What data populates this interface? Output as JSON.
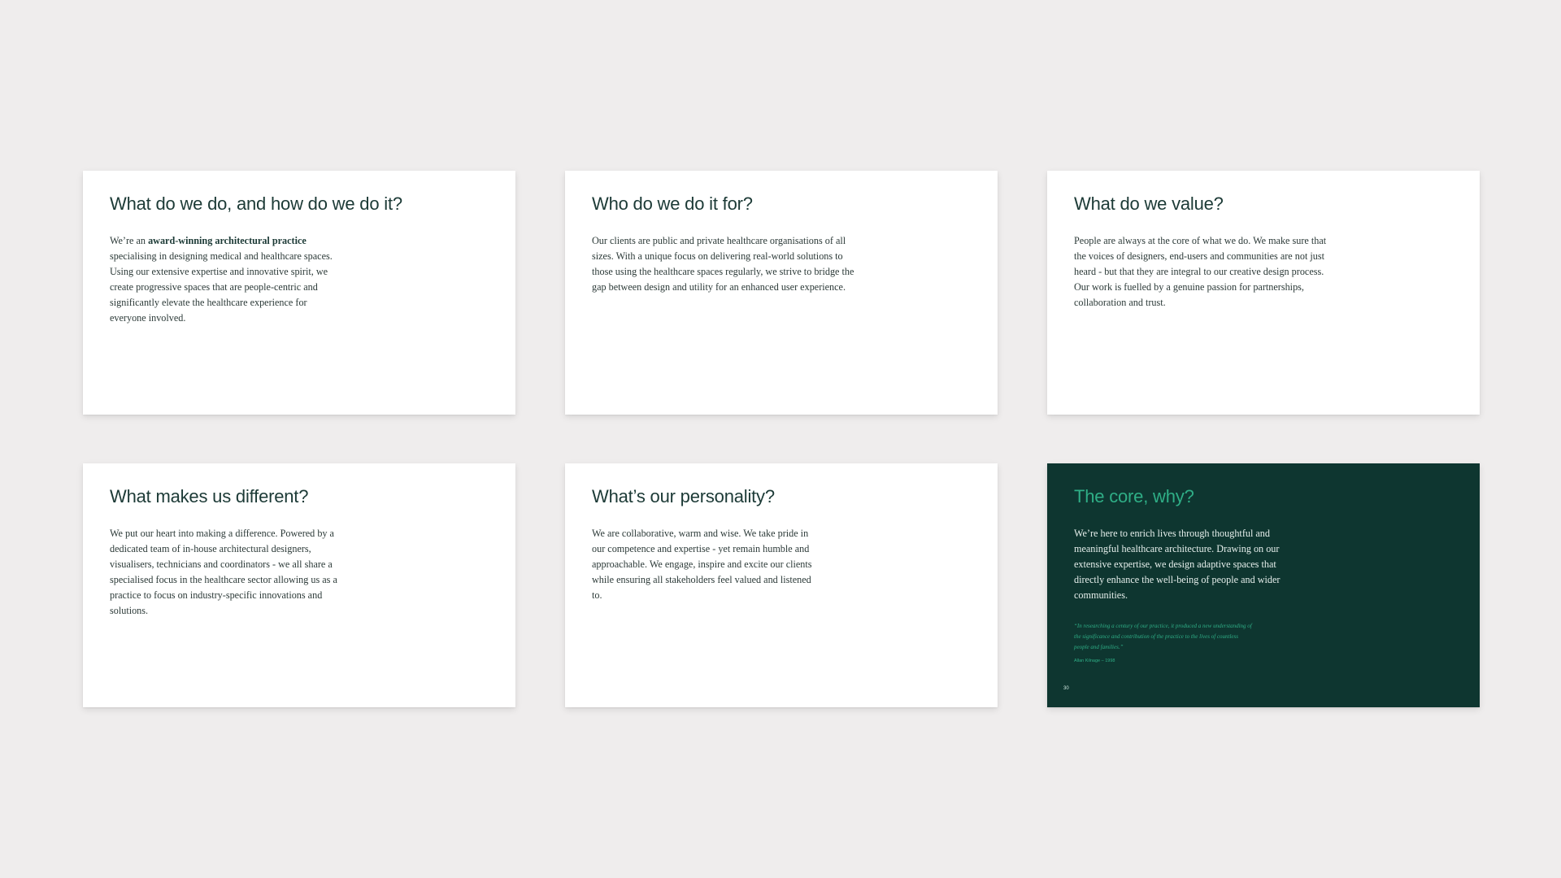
{
  "cards": [
    {
      "title": "What do we do, and how do we do it?",
      "body_prefix": "We’re an ",
      "body_bold": "award-winning architectural practice",
      "body": " specialising in designing medical and healthcare spaces. Using our extensive expertise and innovative spirit, we create progressive spaces that are people-centric and significantly elevate the healthcare experience for everyone involved."
    },
    {
      "title": "Who do we do it for?",
      "body": "Our clients are public and private healthcare organisations of all sizes. With a unique focus on delivering real-world solutions to those using the healthcare spaces regularly, we strive to bridge the gap between design and utility for an enhanced user experience."
    },
    {
      "title": "What do we value?",
      "body": "People are always at the core of what we do. We make sure that the voices of designers, end-users and communities are not just heard - but that they are integral to our creative design process. Our work is fuelled by a genuine passion for partnerships, collaboration and trust."
    },
    {
      "title": "What makes us different?",
      "body": "We put our heart into making a difference. Powered by a dedicated team of in-house architectural designers, visualisers, technicians and coordinators - we all share a specialised focus in the healthcare sector allowing us as a practice to focus on industry-specific innovations and solutions."
    },
    {
      "title": "What’s our personality?",
      "body": "We are collaborative, warm and wise. We take pride in our competence and expertise - yet remain humble and approachable. We engage, inspire and excite our clients while ensuring all stakeholders feel valued and listened to."
    },
    {
      "title": "The core, why?",
      "body": "We’re here to enrich lives through thoughtful and meaningful healthcare architecture. Drawing on our extensive expertise, we design adaptive spaces that directly enhance the well-being of people and wider communities.",
      "quote": "“In researching a century of our practice, it produced a new understanding of the significance and contribution of the practice to the lives of countless people and families.”",
      "attribution": "Allan Kilnage – 1998",
      "page_number": "30"
    }
  ],
  "colors": {
    "background": "#efeded",
    "card": "#ffffff",
    "dark_card": "#0e3630",
    "heading": "#1c3a36",
    "accent": "#2fae86"
  }
}
